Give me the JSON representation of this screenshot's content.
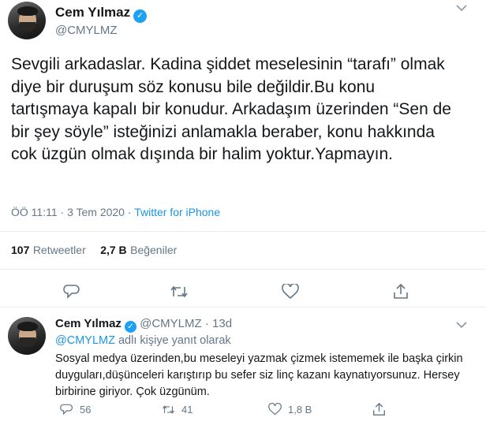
{
  "main_tweet": {
    "author_name": "Cem Yılmaz",
    "handle": "@CMYLMZ",
    "text": "Sevgili arkadaslar. Kadina şiddet meselesinin “tarafı” olmak diye bir duruşum söz konusu bile değildir.Bu konu tartışmaya kapalı bir konudur. Arkadaşım üzerinden “Sen de bir şey söyle” isteğinizi anlamakla beraber, konu hakkında cok üzgün olmak dışında bir halim yoktur.Yapmayın.",
    "timestamp": "ÖÖ 11:11 · 3 Tem 2020",
    "separator": "·",
    "source": "Twitter for iPhone",
    "retweets_count": "107",
    "retweets_label": "Retweetler",
    "likes_count": "2,7 B",
    "likes_label": "Beğeniler"
  },
  "reply_tweet": {
    "author_name": "Cem Yılmaz",
    "handle": "@CMYLMZ",
    "dot": "·",
    "age": "13d",
    "replying_mention": "@CMYLMZ",
    "replying_suffix": "adlı kişiye yanıt olarak",
    "text": "Sosyal medya üzerinden,bu meseleyi yazmak çizmek istememek ile başka çirkin duyguları,düşünceleri karıştırıp bu sefer siz linç kazanı kaynatıyorsunuz. Hersey birbirine giriyor. Çok üzgünüm.",
    "reply_count": "56",
    "retweet_count": "41",
    "like_count": "1,8 B"
  },
  "icons": {
    "verified": "✓",
    "chevron": "⌄"
  },
  "colors": {
    "link": "#1b95e0",
    "muted": "#657786",
    "verified": "#1da1f2",
    "divider": "#e6ecf0"
  }
}
